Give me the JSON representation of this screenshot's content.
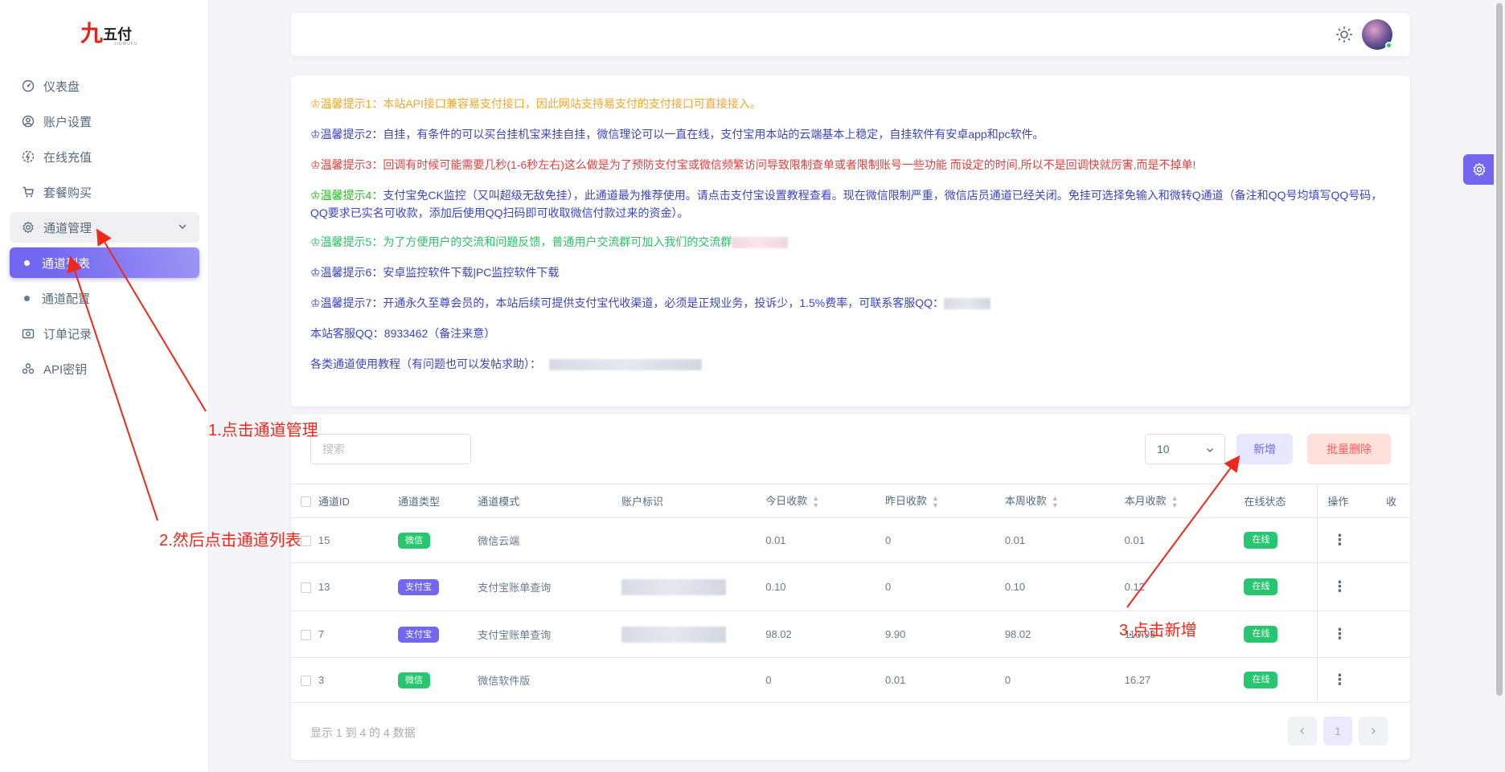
{
  "logo": {
    "text": "五付",
    "mark": "九",
    "sub": "JIUWUFU"
  },
  "sidebar": {
    "items": [
      {
        "label": "仪表盘",
        "icon": "gauge-icon"
      },
      {
        "label": "账户设置",
        "icon": "user-circle-icon"
      },
      {
        "label": "在线充值",
        "icon": "recharge-icon"
      },
      {
        "label": "套餐购买",
        "icon": "cart-icon"
      },
      {
        "label": "通道管理",
        "icon": "settings-icon"
      },
      {
        "label": "通道列表"
      },
      {
        "label": "通道配置"
      },
      {
        "label": "订单记录",
        "icon": "camera-icon"
      },
      {
        "label": "API密钥",
        "icon": "key-icon"
      }
    ]
  },
  "notice": {
    "lines": [
      {
        "text": "♔温馨提示1：本站API接口兼容易支付接口，因此网站支持易支付的支付接口可直接接入。",
        "color": "#f5a623"
      },
      {
        "text": "♔温馨提示2：自挂，有条件的可以买台挂机宝来挂自挂，微信理论可以一直在线，支付宝用本站的云端基本上稳定，自挂软件有安卓app和pc软件。",
        "color": "#3a45c8"
      },
      {
        "text": "♔温馨提示3：回调有时候可能需要几秒(1-6秒左右)这么做是为了预防支付宝或微信频繁访问导致限制查单或者限制账号一些功能 而设定的时间,所以不是回调快就厉害,而是不掉单!",
        "color": "#e53e3e"
      },
      {
        "text": "♔温馨提示4：支付宝免CK监控（又叫超级无敌免挂），此通道最为推荐使用。请点击支付宝设置教程查看。现在微信限制严重，微信店员通道已经关闭。免挂可选择免输入和微转Q通道（备注和QQ号均填写QQ号码，QQ要求已实名可收款，添加后使用QQ扫码即可收取微信付款过来的资金）。",
        "color": "#3a45c8"
      },
      {
        "text": "♔温馨提示5：为了方便用户的交流和问题反馈，普通用户交流群可加入我们的交流群",
        "color": "#2cbf63"
      },
      {
        "text": "♔温馨提示6：安卓监控软件下载|PC监控软件下载",
        "color": "#3a45c8"
      },
      {
        "text": "♔温馨提示7：开通永久至尊会员的，本站后续可提供支付宝代收渠道，必须是正规业务，投诉少，1.5%费率，可联系客服QQ：",
        "color": "#3a45c8"
      },
      {
        "text": "本站客服QQ：8933462（备注来意）",
        "color": "#3a45c8"
      },
      {
        "text": "各类通道使用教程（有问题也可以发帖求助）：",
        "color": "#3a45c8"
      }
    ],
    "tip4_prefix": "♔温馨提示4：",
    "tip4_prefix_color": "#22c11e"
  },
  "table": {
    "search_placeholder": "搜索",
    "page_size": "10",
    "add_label": "新增",
    "batch_delete_label": "批量删除",
    "columns": [
      "通道ID",
      "通道类型",
      "通道模式",
      "账户标识",
      "今日收款",
      "昨日收款",
      "本周收款",
      "本月收款",
      "在线状态",
      "操作",
      "收"
    ],
    "rows": [
      {
        "id": "15",
        "type": "微信",
        "type_color": "green",
        "mode": "微信云端",
        "today": "0.01",
        "yesterday": "0",
        "week": "0.01",
        "month": "0.01",
        "status": "在线"
      },
      {
        "id": "13",
        "type": "支付宝",
        "type_color": "purple",
        "mode": "支付宝账单查询",
        "today": "0.10",
        "yesterday": "0",
        "week": "0.10",
        "month": "0.12",
        "status": "在线"
      },
      {
        "id": "7",
        "type": "支付宝",
        "type_color": "purple",
        "mode": "支付宝账单查询",
        "today": "98.02",
        "yesterday": "9.90",
        "week": "98.02",
        "month": "110.93",
        "status": "在线"
      },
      {
        "id": "3",
        "type": "微信",
        "type_color": "green",
        "mode": "微信软件版",
        "today": "0",
        "yesterday": "0.01",
        "week": "0",
        "month": "16.27",
        "status": "在线"
      }
    ],
    "footer": "显示 1 到 4 的 4 数据",
    "current_page": "1"
  },
  "annotations": {
    "step1": "1.点击通道管理",
    "step2": "2.然后点击通道列表",
    "step3": "3.点击新增"
  }
}
